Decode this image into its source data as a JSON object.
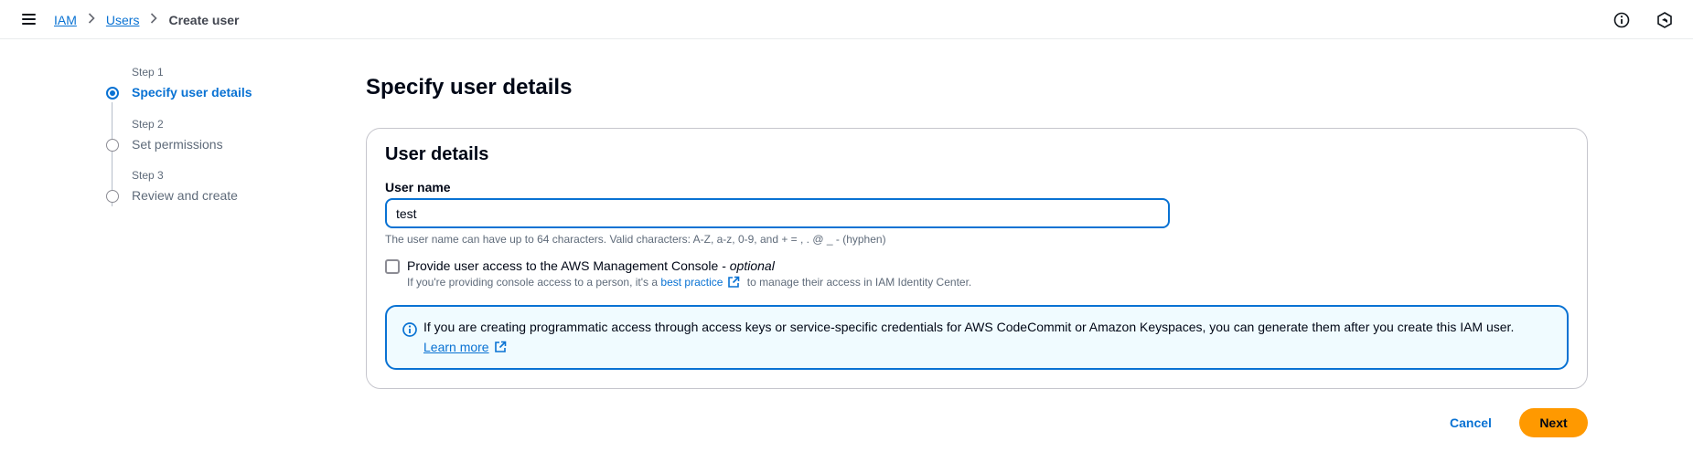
{
  "breadcrumb": {
    "items": [
      "IAM",
      "Users"
    ],
    "current": "Create user"
  },
  "icons": {
    "menu": "hamburger-menu-icon",
    "info": "info-circle-icon",
    "settings": "hexagon-settings-icon",
    "external": "external-link-icon"
  },
  "steps": [
    {
      "kicker": "Step 1",
      "title": "Specify user details",
      "state": "active"
    },
    {
      "kicker": "Step 2",
      "title": "Set permissions",
      "state": "inactive"
    },
    {
      "kicker": "Step 3",
      "title": "Review and create",
      "state": "inactive"
    }
  ],
  "page": {
    "title": "Specify user details"
  },
  "user_details": {
    "section_title": "User details",
    "username_label": "User name",
    "username_value": "test",
    "username_constraint": "The user name can have up to 64 characters. Valid characters: A-Z, a-z, 0-9, and + = , . @ _ - (hyphen)",
    "console_access_label": "Provide user access to the AWS Management Console - ",
    "console_access_optional": "optional",
    "console_access_checked": false,
    "console_desc_prefix": "If you're providing console access to a person, it's a ",
    "console_desc_link": "best practice",
    "console_desc_suffix": " to manage their access in IAM Identity Center."
  },
  "info_alert": {
    "text": "If you are creating programmatic access through access keys or service-specific credentials for AWS CodeCommit or Amazon Keyspaces, you can generate them after you create this IAM user.",
    "link": "Learn more"
  },
  "actions": {
    "cancel": "Cancel",
    "next": "Next"
  },
  "colors": {
    "link": "#0972d3",
    "primary_button": "#ff9900",
    "alert_bg": "#f0fbff"
  }
}
